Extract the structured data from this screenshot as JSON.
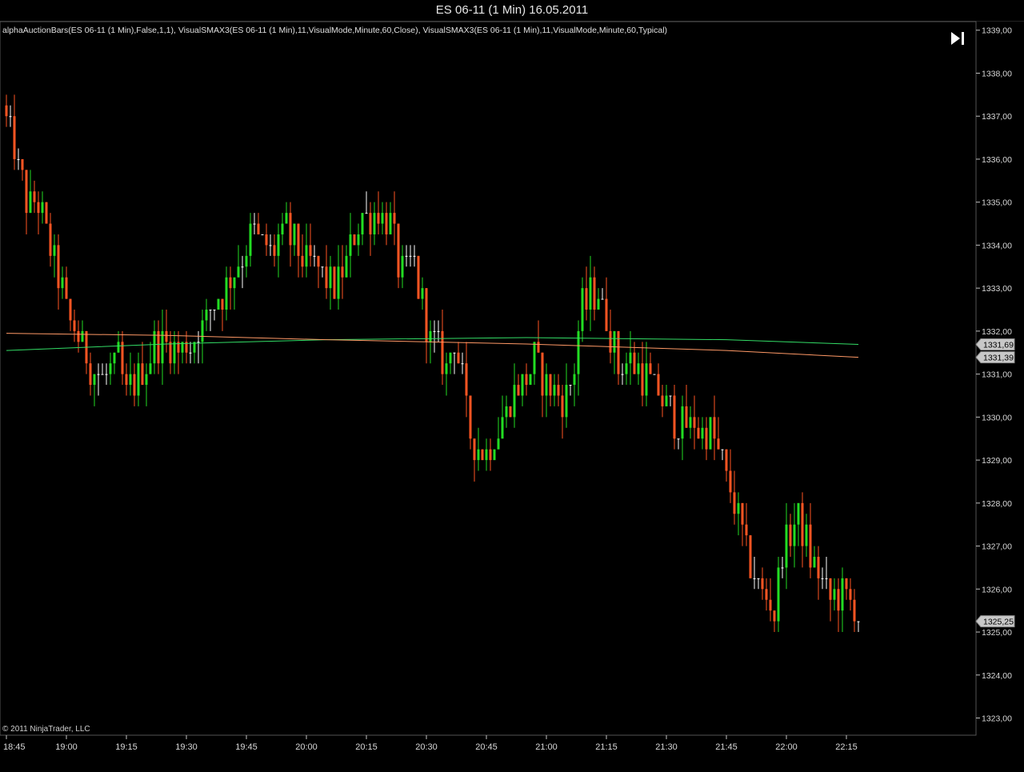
{
  "window": {
    "title": "ES 06-11 (1 Min)  16.05.2011"
  },
  "indicators_label": "alphaAuctionBars(ES 06-11 (1 Min),False,1,1),  VisualSMAX3(ES 06-11 (1 Min),11,VisualMode,Minute,60,Close),  VisualSMAX3(ES 06-11 (1 Min),11,VisualMode,Minute,60,Typical)",
  "copyright": "© 2011 NinjaTrader, LLC",
  "nav": {
    "icon": "skip-to-end-icon"
  },
  "colors": {
    "background": "#000000",
    "up": "#22dd22",
    "down": "#ff5522",
    "neutral": "#ffffff",
    "sma_close": "#33dd66",
    "sma_typical": "#ff9966",
    "axis": "#c0c0c0"
  },
  "chart_data": {
    "type": "candlestick",
    "title": "ES 06-11 (1 Min)  16.05.2011",
    "ylim": [
      1322.6,
      1339.2
    ],
    "y_ticks": [
      "1339,00",
      "1338,00",
      "1337,00",
      "1336,00",
      "1335,00",
      "1334,00",
      "1333,00",
      "1332,00",
      "1331,00",
      "1330,00",
      "1329,00",
      "1328,00",
      "1327,00",
      "1326,00",
      "1325,00",
      "1324,00",
      "1323,00"
    ],
    "x_ticks": [
      "18:45",
      "19:00",
      "19:15",
      "19:30",
      "19:45",
      "20:00",
      "20:15",
      "20:30",
      "20:45",
      "21:00",
      "21:15",
      "21:30",
      "21:45",
      "22:00",
      "22:15"
    ],
    "price_markers": [
      {
        "label": "1331,69",
        "value": 1331.69
      },
      {
        "label": "1331,39",
        "value": 1331.39
      },
      {
        "label": "1325,25",
        "value": 1325.25
      }
    ],
    "series": [
      {
        "name": "VisualSMAX3 Close",
        "color": "#33dd66",
        "points": [
          [
            0,
            1331.55
          ],
          [
            40,
            1331.7
          ],
          [
            80,
            1331.8
          ],
          [
            130,
            1331.85
          ],
          [
            180,
            1331.8
          ],
          [
            213,
            1331.69
          ]
        ]
      },
      {
        "name": "VisualSMAX3 Typical",
        "color": "#ff9966",
        "points": [
          [
            0,
            1331.95
          ],
          [
            40,
            1331.9
          ],
          [
            80,
            1331.8
          ],
          [
            130,
            1331.7
          ],
          [
            180,
            1331.55
          ],
          [
            213,
            1331.39
          ]
        ]
      }
    ],
    "waypoints": [
      [
        0,
        1336.9
      ],
      [
        5,
        1335.1
      ],
      [
        8,
        1334.9
      ],
      [
        12,
        1333.6
      ],
      [
        16,
        1332.2
      ],
      [
        20,
        1331.4
      ],
      [
        24,
        1330.8
      ],
      [
        28,
        1331.3
      ],
      [
        30,
        1330.5
      ],
      [
        34,
        1331.2
      ],
      [
        38,
        1331.8
      ],
      [
        42,
        1331.6
      ],
      [
        46,
        1331.7
      ],
      [
        50,
        1332.3
      ],
      [
        54,
        1332.9
      ],
      [
        58,
        1333.6
      ],
      [
        62,
        1334.3
      ],
      [
        66,
        1333.8
      ],
      [
        70,
        1334.3
      ],
      [
        74,
        1333.7
      ],
      [
        78,
        1333.5
      ],
      [
        82,
        1332.9
      ],
      [
        85,
        1333.5
      ],
      [
        88,
        1334.6
      ],
      [
        92,
        1334.8
      ],
      [
        96,
        1334.5
      ],
      [
        98,
        1333.4
      ],
      [
        102,
        1333.5
      ],
      [
        104,
        1332.6
      ],
      [
        106,
        1331.8
      ],
      [
        110,
        1331.1
      ],
      [
        112,
        1331.9
      ],
      [
        116,
        1329.6
      ],
      [
        120,
        1329.1
      ],
      [
        124,
        1330.0
      ],
      [
        128,
        1330.7
      ],
      [
        132,
        1331.3
      ],
      [
        136,
        1330.6
      ],
      [
        140,
        1330.5
      ],
      [
        142,
        1331.2
      ],
      [
        144,
        1332.6
      ],
      [
        148,
        1332.9
      ],
      [
        150,
        1332.2
      ],
      [
        153,
        1331.2
      ],
      [
        156,
        1331.2
      ],
      [
        160,
        1330.9
      ],
      [
        164,
        1330.4
      ],
      [
        168,
        1329.9
      ],
      [
        172,
        1329.8
      ],
      [
        176,
        1329.6
      ],
      [
        180,
        1328.6
      ],
      [
        184,
        1327.2
      ],
      [
        188,
        1326.1
      ],
      [
        192,
        1325.5
      ],
      [
        194,
        1327.0
      ],
      [
        198,
        1327.6
      ],
      [
        202,
        1326.5
      ],
      [
        206,
        1325.8
      ],
      [
        210,
        1325.9
      ],
      [
        213,
        1325.3
      ]
    ],
    "n_bars": 214,
    "bar_interval_min": 1,
    "start_time": "18:45",
    "end_time": "22:15"
  }
}
